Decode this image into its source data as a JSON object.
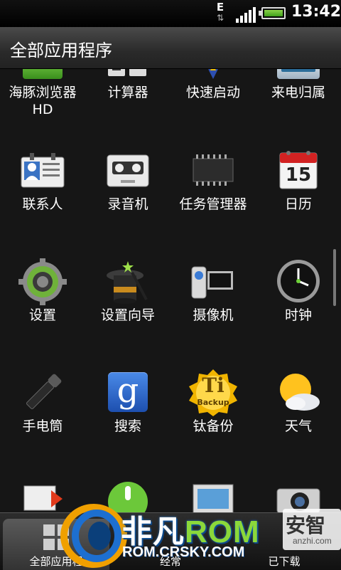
{
  "status_bar": {
    "network": "E",
    "time": "13:42"
  },
  "title": "全部应用程序",
  "apps": [
    {
      "label": "海豚浏览器\nHD",
      "icon": "dolphin-browser-icon"
    },
    {
      "label": "计算器",
      "icon": "calculator-icon"
    },
    {
      "label": "快速启动",
      "icon": "quick-launch-icon"
    },
    {
      "label": "来电归属",
      "icon": "caller-location-icon"
    },
    {
      "label": "联系人",
      "icon": "contacts-icon"
    },
    {
      "label": "录音机",
      "icon": "recorder-icon"
    },
    {
      "label": "任务管理器",
      "icon": "task-manager-icon"
    },
    {
      "label": "日历",
      "icon": "calendar-icon",
      "day": "15"
    },
    {
      "label": "设置",
      "icon": "gear-icon"
    },
    {
      "label": "设置向导",
      "icon": "setup-wizard-icon"
    },
    {
      "label": "摄像机",
      "icon": "camcorder-icon"
    },
    {
      "label": "时钟",
      "icon": "clock-icon"
    },
    {
      "label": "手电筒",
      "icon": "flashlight-icon"
    },
    {
      "label": "搜索",
      "icon": "google-search-icon",
      "glyph": "g"
    },
    {
      "label": "钛备份",
      "icon": "titanium-backup-icon",
      "badge_top": "Ti",
      "badge_bottom": "Backup"
    },
    {
      "label": "天气",
      "icon": "weather-icon"
    },
    {
      "label": "",
      "icon": "mail-icon"
    },
    {
      "label": "",
      "icon": "market-icon"
    },
    {
      "label": "",
      "icon": "gallery-icon"
    },
    {
      "label": "",
      "icon": "camera-icon"
    }
  ],
  "tabs": [
    {
      "label": "全部应用程",
      "icon": "all-apps-icon",
      "active": true
    },
    {
      "label": "经常",
      "icon": "frequent-icon",
      "active": false
    },
    {
      "label": "已下载",
      "icon": "downloaded-icon",
      "active": false
    }
  ],
  "watermark": {
    "title_a": "非凡",
    "title_b": "ROM",
    "subtitle": "ROM.CRSKY.COM",
    "right_text": "安智",
    "right_url": "anzhi.com"
  },
  "colors": {
    "background": "#161616",
    "titlebar": "#333333",
    "battery": "#5cbf2a"
  }
}
